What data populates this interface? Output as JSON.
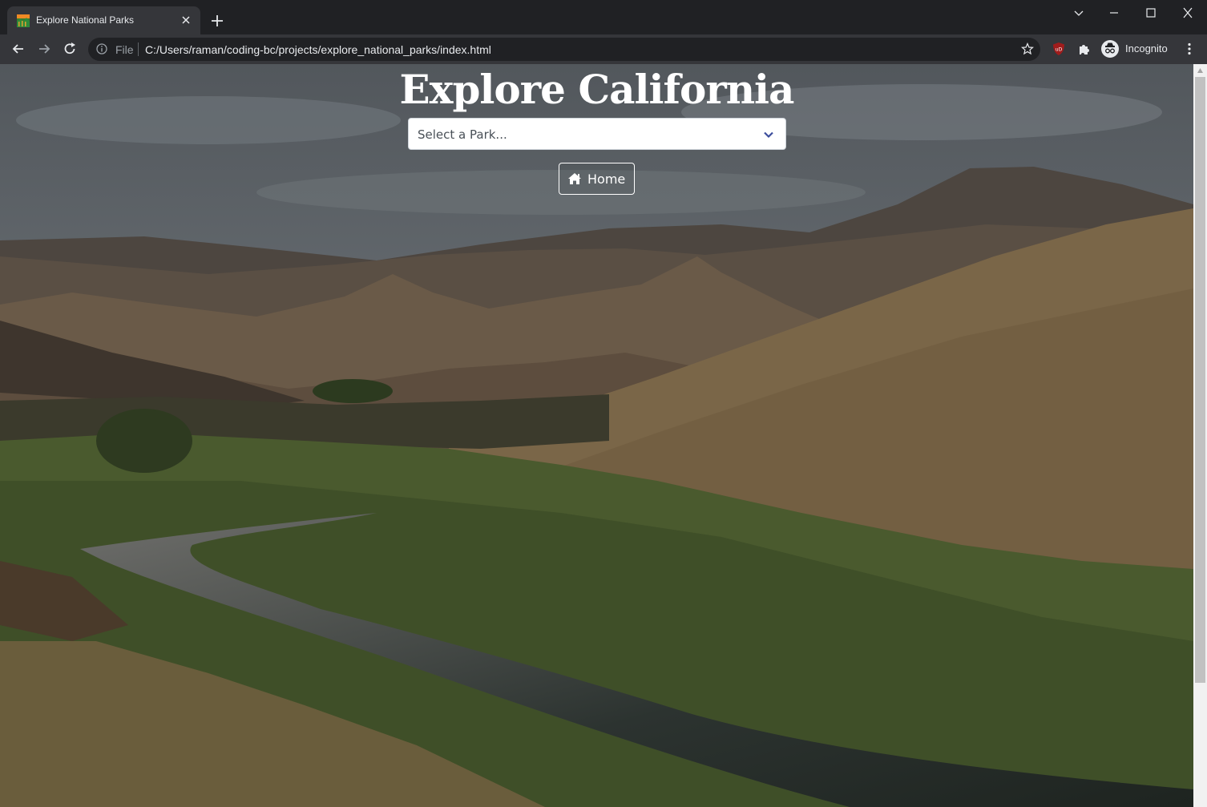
{
  "browser": {
    "tab_title": "Explore National Parks",
    "omnibox": {
      "scheme_label": "File",
      "url": "C:/Users/raman/coding-bc/projects/explore_national_parks/index.html"
    },
    "profile_label": "Incognito"
  },
  "page": {
    "title": "Explore California",
    "park_select": {
      "selected_text": "Select a Park..."
    },
    "home_button_label": "Home"
  },
  "colors": {
    "chrome_dark": "#202124",
    "chrome_toolbar": "#35363a",
    "text_light": "#e8eaed",
    "ublock_red": "#a01c1c"
  },
  "icons": [
    "favicon-icon",
    "close-tab-icon",
    "new-tab-icon",
    "back-icon",
    "forward-icon",
    "reload-icon",
    "info-icon",
    "bookmark-star-icon",
    "ublock-icon",
    "extensions-icon",
    "incognito-icon",
    "menu-icon",
    "chevron-down-icon",
    "home-icon"
  ]
}
